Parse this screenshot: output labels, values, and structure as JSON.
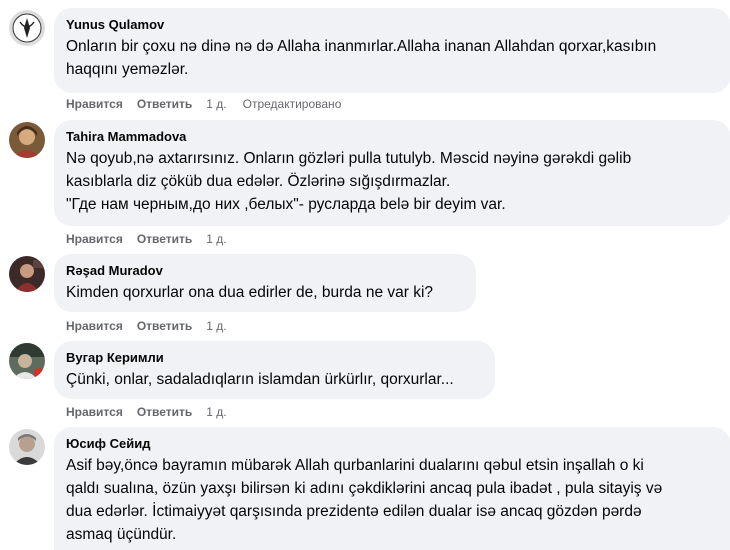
{
  "actions": {
    "like": "Нравится",
    "reply": "Ответить"
  },
  "comments": [
    {
      "author": "Yunus Qulamov",
      "lines": [
        "Onların bir çoxu nə dinə nə də Allaha inanmırlar.Allaha inanan Allahdan qorxar,kasıbın",
        "haqqını yeməzlər."
      ],
      "time": "1 д.",
      "edited": "Отредактировано"
    },
    {
      "author": "Tahira Mammadova",
      "lines": [
        "Nə qoyub,nə axtarırsınız. Onların gözləri pulla tutulyb. Məscid nəyinə gərəkdi gəlib",
        "kasıblarla diz çöküb dua edələr. Özlərinə sığışdırmazlar.",
        "\"Где нам черным,до них ,белых\"- русларда belə bir deyim var."
      ],
      "time": "1 д."
    },
    {
      "author": "Rəşad Muradov",
      "lines": [
        "Kimden qorxurlar ona dua edirler de, burda ne var ki?"
      ],
      "time": "1 д."
    },
    {
      "author": "Вугар Керимли",
      "lines": [
        "Çünki, onlar, sadaladıqların islamdan ürkürlır, qorxurlar..."
      ],
      "time": "1 д."
    },
    {
      "author": "Юсиф Сейид",
      "lines": [
        "Asif bəy,öncə bayramın mübarək Allah qurbanlarini dualarını qəbul etsin inşallah o ki",
        "qaldı sualına, özün yaxşı bilirsən ki adını çəkdiklərini ancaq pula ibadət , pula sitayiş və",
        "dua edərlər. İctimaiyyət qarşısında prezidentə edilən dualar isə ancaq gözdən pərdə",
        "asmaq üçündür."
      ]
    }
  ]
}
